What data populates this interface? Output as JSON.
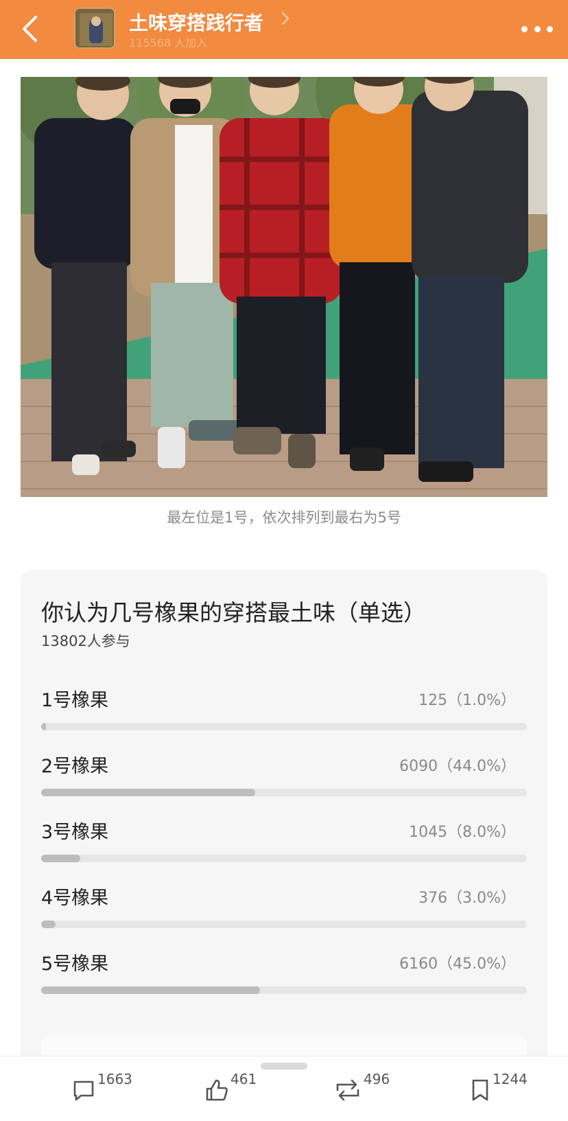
{
  "header": {
    "title": "土味穿搭践行者",
    "members": "115568 人加入",
    "icons": {
      "back": "chevron-left-icon",
      "more": "more-dots-icon",
      "title_arrow": "chevron-right-icon"
    }
  },
  "post": {
    "caption": "最左位是1号，依次排列到最右为5号"
  },
  "poll": {
    "question": "你认为几号橡果的穿搭最土味（单选）",
    "participants": "13802人参与",
    "options": [
      {
        "label": "1号橡果",
        "result": "125（1.0%）",
        "percent": 1.0
      },
      {
        "label": "2号橡果",
        "result": "6090（44.0%）",
        "percent": 44.0
      },
      {
        "label": "3号橡果",
        "result": "1045（8.0%）",
        "percent": 8.0
      },
      {
        "label": "4号橡果",
        "result": "376（3.0%）",
        "percent": 3.0
      },
      {
        "label": "5号橡果",
        "result": "6160（45.0%）",
        "percent": 45.0
      }
    ]
  },
  "actions": {
    "comments": "1663",
    "likes": "461",
    "reposts": "496",
    "favorites": "1244"
  },
  "colors": {
    "header_bg": "#f28a3f",
    "bar_fill": "#bdbdbd",
    "bar_track": "#e6e6e6"
  }
}
